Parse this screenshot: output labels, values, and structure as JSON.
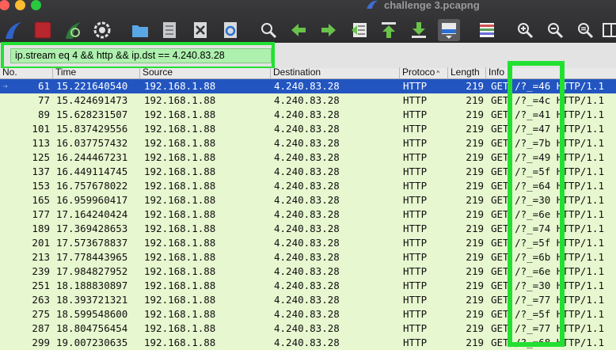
{
  "window": {
    "title": "challenge 3.pcapng"
  },
  "toolbar": {
    "icons": [
      "wireshark-fin-icon",
      "stop-capture-icon",
      "restart-capture-icon",
      "capture-options-icon",
      "open-file-icon",
      "save-file-icon",
      "close-file-icon",
      "reload-file-icon",
      "find-packet-icon",
      "go-back-icon",
      "go-forward-icon",
      "go-to-packet-icon",
      "go-first-icon",
      "go-last-icon",
      "autoscroll-icon",
      "colorize-icon",
      "zoom-in-icon",
      "zoom-out-icon",
      "zoom-normal-icon",
      "resize-columns-icon"
    ]
  },
  "filter": {
    "value": "ip.stream eq 4 && http && ip.dst == 4.240.83.28"
  },
  "columns": {
    "no": "No.",
    "time": "Time",
    "source": "Source",
    "destination": "Destination",
    "protocol": "Protoco",
    "length": "Length",
    "info": "Info"
  },
  "colors": {
    "selected_row": "#2255c0",
    "row_bg": "#e7f7cf",
    "highlight": "#22e032",
    "filter_bg": "#aef0ae"
  },
  "packets": [
    {
      "no": "61",
      "time": "15.221640540",
      "source": "192.168.1.88",
      "destination": "4.240.83.28",
      "protocol": "HTTP",
      "length": "219",
      "info": "GET /?_=46 HTTP/1.1",
      "selected": true
    },
    {
      "no": "77",
      "time": "15.424691473",
      "source": "192.168.1.88",
      "destination": "4.240.83.28",
      "protocol": "HTTP",
      "length": "219",
      "info": "GET /?_=4c HTTP/1.1"
    },
    {
      "no": "89",
      "time": "15.628231507",
      "source": "192.168.1.88",
      "destination": "4.240.83.28",
      "protocol": "HTTP",
      "length": "219",
      "info": "GET /?_=41 HTTP/1.1"
    },
    {
      "no": "101",
      "time": "15.837429556",
      "source": "192.168.1.88",
      "destination": "4.240.83.28",
      "protocol": "HTTP",
      "length": "219",
      "info": "GET /?_=47 HTTP/1.1"
    },
    {
      "no": "113",
      "time": "16.037757432",
      "source": "192.168.1.88",
      "destination": "4.240.83.28",
      "protocol": "HTTP",
      "length": "219",
      "info": "GET /?_=7b HTTP/1.1"
    },
    {
      "no": "125",
      "time": "16.244467231",
      "source": "192.168.1.88",
      "destination": "4.240.83.28",
      "protocol": "HTTP",
      "length": "219",
      "info": "GET /?_=49 HTTP/1.1"
    },
    {
      "no": "137",
      "time": "16.449114745",
      "source": "192.168.1.88",
      "destination": "4.240.83.28",
      "protocol": "HTTP",
      "length": "219",
      "info": "GET /?_=5f HTTP/1.1"
    },
    {
      "no": "153",
      "time": "16.757678022",
      "source": "192.168.1.88",
      "destination": "4.240.83.28",
      "protocol": "HTTP",
      "length": "219",
      "info": "GET /?_=64 HTTP/1.1"
    },
    {
      "no": "165",
      "time": "16.959960417",
      "source": "192.168.1.88",
      "destination": "4.240.83.28",
      "protocol": "HTTP",
      "length": "219",
      "info": "GET /?_=30 HTTP/1.1"
    },
    {
      "no": "177",
      "time": "17.164240424",
      "source": "192.168.1.88",
      "destination": "4.240.83.28",
      "protocol": "HTTP",
      "length": "219",
      "info": "GET /?_=6e HTTP/1.1"
    },
    {
      "no": "189",
      "time": "17.369428653",
      "source": "192.168.1.88",
      "destination": "4.240.83.28",
      "protocol": "HTTP",
      "length": "219",
      "info": "GET /?_=74 HTTP/1.1"
    },
    {
      "no": "201",
      "time": "17.573678837",
      "source": "192.168.1.88",
      "destination": "4.240.83.28",
      "protocol": "HTTP",
      "length": "219",
      "info": "GET /?_=5f HTTP/1.1"
    },
    {
      "no": "213",
      "time": "17.778443965",
      "source": "192.168.1.88",
      "destination": "4.240.83.28",
      "protocol": "HTTP",
      "length": "219",
      "info": "GET /?_=6b HTTP/1.1"
    },
    {
      "no": "239",
      "time": "17.984827952",
      "source": "192.168.1.88",
      "destination": "4.240.83.28",
      "protocol": "HTTP",
      "length": "219",
      "info": "GET /?_=6e HTTP/1.1"
    },
    {
      "no": "251",
      "time": "18.188830897",
      "source": "192.168.1.88",
      "destination": "4.240.83.28",
      "protocol": "HTTP",
      "length": "219",
      "info": "GET /?_=30 HTTP/1.1"
    },
    {
      "no": "263",
      "time": "18.393721321",
      "source": "192.168.1.88",
      "destination": "4.240.83.28",
      "protocol": "HTTP",
      "length": "219",
      "info": "GET /?_=77 HTTP/1.1"
    },
    {
      "no": "275",
      "time": "18.599548600",
      "source": "192.168.1.88",
      "destination": "4.240.83.28",
      "protocol": "HTTP",
      "length": "219",
      "info": "GET /?_=5f HTTP/1.1"
    },
    {
      "no": "287",
      "time": "18.804756454",
      "source": "192.168.1.88",
      "destination": "4.240.83.28",
      "protocol": "HTTP",
      "length": "219",
      "info": "GET /?_=77 HTTP/1.1"
    },
    {
      "no": "299",
      "time": "19.007230635",
      "source": "192.168.1.88",
      "destination": "4.240.83.28",
      "protocol": "HTTP",
      "length": "219",
      "info": "GET /?_=68 HTTP/1.1"
    }
  ]
}
